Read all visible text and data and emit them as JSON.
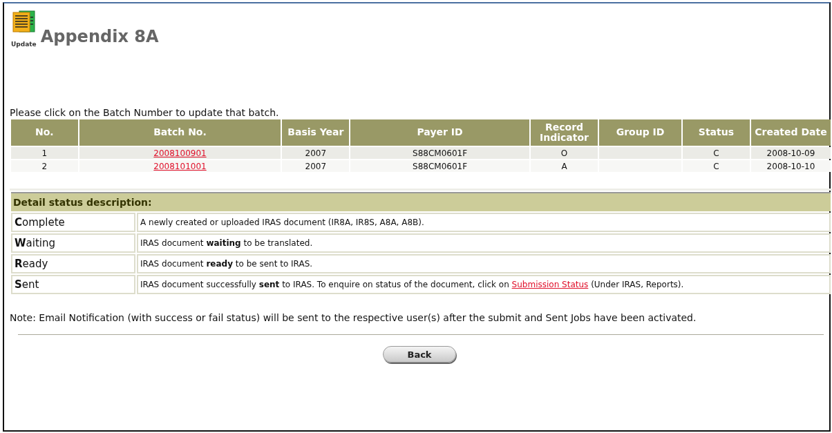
{
  "header": {
    "icon_label": "Update",
    "title": "Appendix 8A"
  },
  "instruction": "Please click on the Batch Number to update that batch.",
  "batch_table": {
    "columns": [
      "No.",
      "Batch No.",
      "Basis Year",
      "Payer ID",
      "Record Indicator",
      "Group ID",
      "Status",
      "Created Date"
    ],
    "rows": [
      {
        "no": "1",
        "batch_no": "2008100901",
        "basis_year": "2007",
        "payer_id": "S88CM0601F",
        "record_indicator": "O",
        "group_id": "",
        "status": "C",
        "created_date": "2008-10-09"
      },
      {
        "no": "2",
        "batch_no": "2008101001",
        "basis_year": "2007",
        "payer_id": "S88CM0601F",
        "record_indicator": "A",
        "group_id": "",
        "status": "C",
        "created_date": "2008-10-10"
      }
    ]
  },
  "status_descriptions": {
    "title": "Detail status description:",
    "items": [
      {
        "name": "**C**omplete",
        "description": "A newly created or uploaded IRAS document (IR8A, IR8S, A8A, A8B)."
      },
      {
        "name": "**W**aiting",
        "description": "IRAS document **waiting** to be translated."
      },
      {
        "name": "**R**eady",
        "description": "IRAS document **ready** to be sent to IRAS."
      },
      {
        "name": "**S**ent",
        "description": "IRAS document successfully **sent** to IRAS. To enquire on status of the document, click on",
        "link": "Submission Status",
        "description_after": "(Under IRAS, Reports)."
      }
    ]
  },
  "note": "Note: Email Notification (with success or fail status) will be sent to the respective user(s) after the submit and Sent Jobs have been activated.",
  "buttons": [
    "Back"
  ]
}
